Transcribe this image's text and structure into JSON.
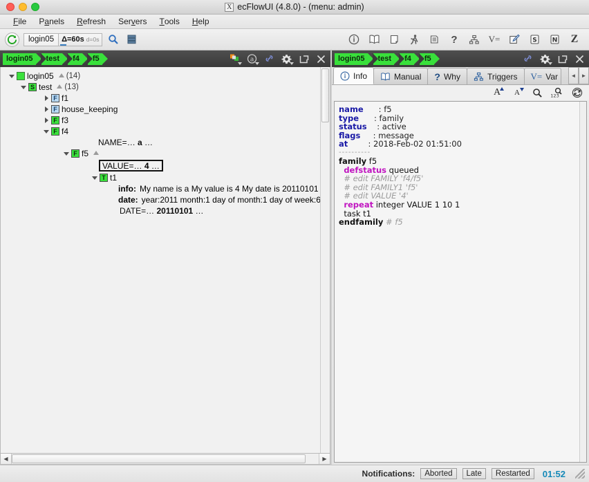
{
  "window": {
    "title": "ecFlowUI (4.8.0) - (menu: admin)",
    "app_icon": "X",
    "buttons": {
      "close": "close-button",
      "minimize": "minimize-button",
      "maximize": "maximize-button"
    }
  },
  "menubar": {
    "items": [
      {
        "label": "File",
        "mnemonic": "F"
      },
      {
        "label": "Panels",
        "mnemonic": "P"
      },
      {
        "label": "Refresh",
        "mnemonic": "R"
      },
      {
        "label": "Servers",
        "mnemonic": "v"
      },
      {
        "label": "Tools",
        "mnemonic": "T"
      },
      {
        "label": "Help",
        "mnemonic": "H"
      }
    ]
  },
  "toolbar": {
    "refresh_label": "C",
    "server_name": "login05",
    "delta_primary": "Δ=60s",
    "delta_secondary": "d=0s",
    "search_icon": "search-icon",
    "servers_icon": "servers-icon",
    "right_icons": [
      {
        "name": "info-icon",
        "glyph": "i"
      },
      {
        "name": "manual-icon",
        "glyph": "book"
      },
      {
        "name": "script-icon",
        "glyph": "scroll"
      },
      {
        "name": "job-status-icon",
        "glyph": "runner"
      },
      {
        "name": "output-icon",
        "glyph": "printer"
      },
      {
        "name": "why-icon",
        "glyph": "?"
      },
      {
        "name": "triggers-icon",
        "glyph": "hierarchy"
      },
      {
        "name": "variables-icon",
        "glyph": "V="
      },
      {
        "name": "edit-icon",
        "glyph": "pencil"
      },
      {
        "name": "suite-icon",
        "glyph": "S"
      },
      {
        "name": "node-icon",
        "glyph": "N"
      },
      {
        "name": "zombies-icon",
        "glyph": "Z"
      }
    ]
  },
  "left_panel": {
    "breadcrumb": [
      "login05",
      "test",
      "f4",
      "f5"
    ],
    "header_icons": [
      {
        "name": "node-colour-icon"
      },
      {
        "name": "attribute-filter-icon"
      },
      {
        "name": "link-icon"
      },
      {
        "name": "settings-icon"
      },
      {
        "name": "detach-icon"
      },
      {
        "name": "close-panel-icon"
      }
    ],
    "tree": [
      {
        "indent": 0,
        "twisty": "down",
        "badge": "plain",
        "badge_text": "",
        "label": "login05",
        "tri": true,
        "count": "(14)",
        "kind": "server"
      },
      {
        "indent": 1,
        "twisty": "down",
        "badge": "green",
        "badge_text": "S",
        "label": "test",
        "tri": true,
        "count": "(13)",
        "kind": "suite"
      },
      {
        "indent": 2,
        "twisty": "right",
        "badge": "blue",
        "badge_text": "F",
        "label": "f1",
        "tri": false,
        "count": "",
        "kind": "family"
      },
      {
        "indent": 2,
        "twisty": "right",
        "badge": "blue",
        "badge_text": "F",
        "label": "house_keeping",
        "tri": false,
        "count": "",
        "kind": "family"
      },
      {
        "indent": 2,
        "twisty": "right",
        "badge": "green",
        "badge_text": "F",
        "label": "f3",
        "tri": false,
        "count": "",
        "kind": "family"
      },
      {
        "indent": 2,
        "twisty": "down",
        "badge": "green",
        "badge_text": "F",
        "label": "f4",
        "tri": false,
        "count": "",
        "kind": "family"
      },
      {
        "indent": 4,
        "twisty": "none",
        "badge": "none",
        "badge_text": "",
        "label": "NAME=",
        "kind": "attr-var",
        "value": "a",
        "ellipsis": true
      },
      {
        "indent": 3,
        "twisty": "down",
        "badge": "green",
        "badge_text": "F",
        "label": "f5",
        "tri": true,
        "count": "",
        "kind": "family"
      },
      {
        "indent": 5,
        "twisty": "none",
        "badge": "none",
        "badge_text": "",
        "label": "VALUE=",
        "kind": "attr-box",
        "value": "4",
        "ellipsis": true
      },
      {
        "indent": 4,
        "twisty": "down",
        "badge": "green",
        "badge_text": "T",
        "label": "t1",
        "tri": false,
        "count": "",
        "kind": "task"
      },
      {
        "indent": 6,
        "twisty": "none",
        "badge": "none",
        "badge_text": "",
        "label": "info:",
        "kind": "attr-meta",
        "value": "My name is a My value is 4 My date is 20110101"
      },
      {
        "indent": 6,
        "twisty": "none",
        "badge": "none",
        "badge_text": "",
        "label": "date:",
        "kind": "attr-meta",
        "value": "year:2011 month:1 day of month:1 day of week:6"
      },
      {
        "indent": 6,
        "twisty": "none",
        "badge": "none",
        "badge_text": "",
        "label": "DATE=",
        "kind": "attr-var",
        "value": "20110101",
        "ellipsis": true
      }
    ]
  },
  "right_panel": {
    "breadcrumb": [
      "login05",
      "test",
      "f4",
      "f5"
    ],
    "header_icons": [
      {
        "name": "link-icon"
      },
      {
        "name": "settings-icon"
      },
      {
        "name": "detach-icon"
      },
      {
        "name": "close-panel-icon"
      }
    ],
    "tabs": [
      {
        "label": "Info",
        "icon": "info-icon",
        "active": true
      },
      {
        "label": "Manual",
        "icon": "manual-icon",
        "active": false
      },
      {
        "label": "Why",
        "icon": "why-icon",
        "active": false
      },
      {
        "label": "Triggers",
        "icon": "triggers-icon",
        "active": false
      },
      {
        "label": "Var",
        "icon": "variables-icon",
        "active": false
      }
    ],
    "tab_scroll_left": "◄",
    "tab_scroll_right": "►",
    "info_toolbar": [
      {
        "name": "font-increase-icon",
        "glyph": "A"
      },
      {
        "name": "font-decrease-icon",
        "glyph": "A"
      },
      {
        "name": "search-icon",
        "glyph": "search"
      },
      {
        "name": "line-numbers-icon",
        "glyph": "123"
      },
      {
        "name": "reload-icon",
        "glyph": "reload"
      }
    ],
    "info": {
      "fields": [
        {
          "key": "name",
          "value": "f5"
        },
        {
          "key": "type",
          "value": "family"
        },
        {
          "key": "status",
          "value": "active"
        },
        {
          "key": "flags",
          "value": "message"
        },
        {
          "key": "at",
          "value": "2018-Feb-02 01:51:00"
        }
      ],
      "separator": "----------",
      "definition": [
        {
          "indent": 0,
          "parts": [
            {
              "t": "family",
              "s": "kw"
            },
            {
              "t": " f5",
              "s": "plain"
            }
          ]
        },
        {
          "indent": 1,
          "parts": [
            {
              "t": "defstatus",
              "s": "mag"
            },
            {
              "t": " queued",
              "s": "plain"
            }
          ]
        },
        {
          "indent": 1,
          "parts": [
            {
              "t": "# edit FAMILY 'f4/f5'",
              "s": "cmt"
            }
          ]
        },
        {
          "indent": 1,
          "parts": [
            {
              "t": "# edit FAMILY1 'f5'",
              "s": "cmt"
            }
          ]
        },
        {
          "indent": 1,
          "parts": [
            {
              "t": "# edit VALUE '4'",
              "s": "cmt"
            }
          ]
        },
        {
          "indent": 1,
          "parts": [
            {
              "t": "repeat",
              "s": "mag"
            },
            {
              "t": " integer VALUE 1 10 1",
              "s": "plain"
            }
          ]
        },
        {
          "indent": 1,
          "parts": [
            {
              "t": "task t1",
              "s": "plain"
            }
          ]
        },
        {
          "indent": 0,
          "parts": [
            {
              "t": "endfamily",
              "s": "kw"
            },
            {
              "t": " # f5",
              "s": "cmt"
            }
          ]
        }
      ]
    }
  },
  "statusbar": {
    "notifications_label": "Notifications:",
    "chips": [
      "Aborted",
      "Late",
      "Restarted"
    ],
    "clock": "01:52"
  }
}
